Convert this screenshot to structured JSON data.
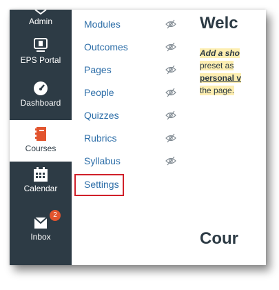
{
  "global_nav": {
    "items": [
      {
        "label": "Admin",
        "icon": "admin-icon"
      },
      {
        "label": "EPS Portal",
        "icon": "eps-portal-icon"
      },
      {
        "label": "Dashboard",
        "icon": "dashboard-icon"
      },
      {
        "label": "Courses",
        "icon": "courses-icon",
        "active": true
      },
      {
        "label": "Calendar",
        "icon": "calendar-icon"
      },
      {
        "label": "Inbox",
        "icon": "inbox-icon",
        "badge": "2"
      }
    ]
  },
  "course_nav": {
    "items": [
      {
        "label": "Modules",
        "hidden_icon": "eye-slash-icon"
      },
      {
        "label": "Outcomes",
        "hidden_icon": "eye-slash-icon"
      },
      {
        "label": "Pages",
        "hidden_icon": "eye-slash-icon"
      },
      {
        "label": "People",
        "hidden_icon": "eye-slash-icon"
      },
      {
        "label": "Quizzes",
        "hidden_icon": "eye-slash-icon"
      },
      {
        "label": "Rubrics",
        "hidden_icon": "eye-slash-icon"
      },
      {
        "label": "Syllabus",
        "hidden_icon": "eye-slash-icon"
      },
      {
        "label": "Settings"
      }
    ]
  },
  "main": {
    "title": "Welc",
    "note_line1": "Add a sho",
    "note_line2": "preset as",
    "note_line3": "personal v",
    "note_line4": "the page.",
    "footer_title": "Cour"
  },
  "colors": {
    "rail_bg": "#2d3b45",
    "link": "#2d6ea8",
    "highlight_box": "#d0202a",
    "badge": "#e2542e"
  }
}
